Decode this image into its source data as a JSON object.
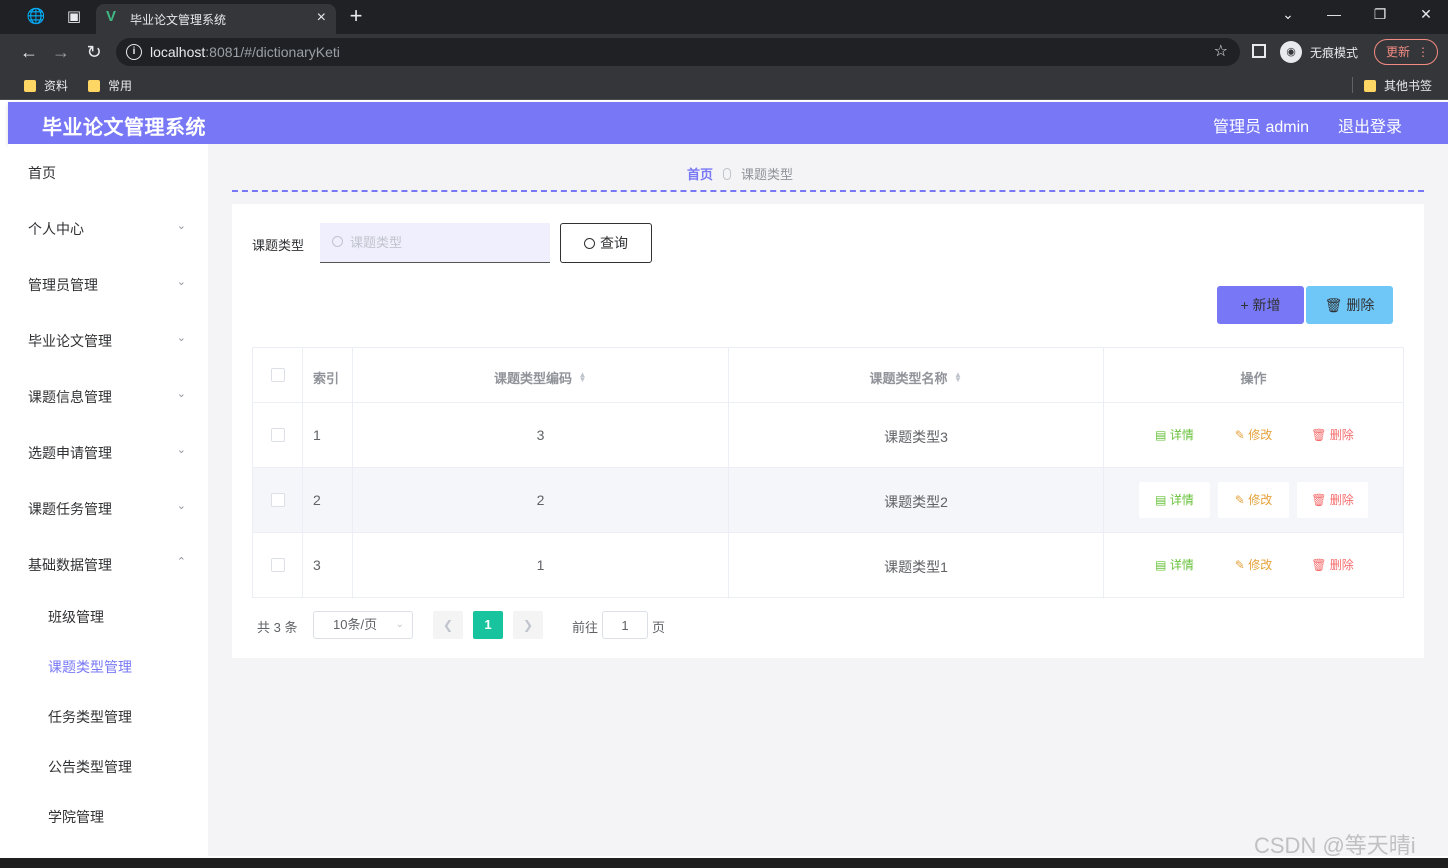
{
  "browser": {
    "tab_title": "毕业论文管理系统",
    "url_host": "localhost",
    "url_path": ":8081/#/dictionaryKeti",
    "incognito_label": "无痕模式",
    "update_label": "更新",
    "bookmarks": [
      "资料",
      "常用"
    ],
    "other_bookmarks": "其他书签"
  },
  "header": {
    "title": "毕业论文管理系统",
    "user": "管理员 admin",
    "logout": "退出登录",
    "accent_color": "#7878f7"
  },
  "sidebar": {
    "items": [
      {
        "label": "首页"
      },
      {
        "label": "个人中心"
      },
      {
        "label": "管理员管理"
      },
      {
        "label": "毕业论文管理"
      },
      {
        "label": "课题信息管理"
      },
      {
        "label": "选题申请管理"
      },
      {
        "label": "课题任务管理"
      },
      {
        "label": "基础数据管理"
      }
    ],
    "sub_items": [
      {
        "label": "班级管理"
      },
      {
        "label": "课题类型管理",
        "active": true
      },
      {
        "label": "任务类型管理"
      },
      {
        "label": "公告类型管理"
      },
      {
        "label": "学院管理"
      }
    ]
  },
  "breadcrumb": {
    "home": "首页",
    "current": "课题类型"
  },
  "search": {
    "label": "课题类型",
    "placeholder": "课题类型",
    "button": "查询"
  },
  "actions": {
    "add": "新增",
    "delete": "删除"
  },
  "table": {
    "headers": {
      "index": "索引",
      "code": "课题类型编码",
      "name": "课题类型名称",
      "ops": "操作"
    },
    "rows": [
      {
        "index": "1",
        "code": "3",
        "name": "课题类型3"
      },
      {
        "index": "2",
        "code": "2",
        "name": "课题类型2"
      },
      {
        "index": "3",
        "code": "1",
        "name": "课题类型1"
      }
    ],
    "row_actions": {
      "detail": "详情",
      "edit": "修改",
      "delete": "删除"
    }
  },
  "pagination": {
    "total": "共 3 条",
    "page_size": "10条/页",
    "current": "1",
    "goto_label": "前往",
    "goto_value": "1",
    "page_suffix": "页"
  },
  "watermark": "CSDN @等天晴i"
}
